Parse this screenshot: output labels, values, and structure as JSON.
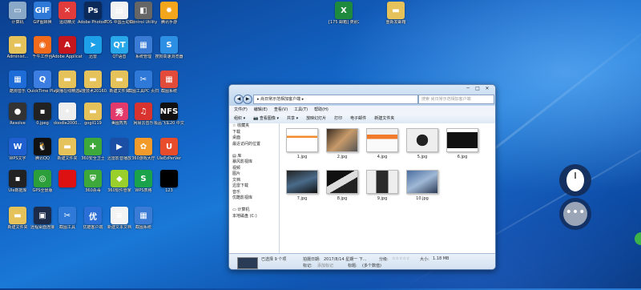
{
  "desktop_icons": [
    {
      "label": "计算机",
      "color": "#8aa9c8",
      "glyph": "▭"
    },
    {
      "label": "GIF图转换",
      "color": "#2f7ad8",
      "glyph": "GIF"
    },
    {
      "label": "运动精灵",
      "color": "#e23b3b",
      "glyph": "✕"
    },
    {
      "label": "Adobe Photosh...",
      "color": "#0b2a59",
      "glyph": "Ps"
    },
    {
      "label": "TDS 中国互动转化…",
      "color": "#f2f2f2",
      "glyph": "▤"
    },
    {
      "label": "Control Utility",
      "color": "#666",
      "glyph": "◧"
    },
    {
      "label": "腾讯手游",
      "color": "#f3a51b",
      "glyph": "✹"
    },
    {
      "label": "Administ...",
      "color": "#e6c25a",
      "glyph": "▬"
    },
    {
      "label": "千牛工作台",
      "color": "#f26a1b",
      "glyph": "◉"
    },
    {
      "label": "Adobe Applicati...",
      "color": "#c4161c",
      "glyph": "A"
    },
    {
      "label": "迅雷",
      "color": "#1ea0e8",
      "glyph": "➤"
    },
    {
      "label": "QT语音",
      "color": "#28a8ea",
      "glyph": "QT"
    },
    {
      "label": "系统管理",
      "color": "#3a7bd5",
      "glyph": "▦"
    },
    {
      "label": "搜狗高速浏览器",
      "color": "#2d8fe3",
      "glyph": "S"
    },
    {
      "label": "酷狗音乐",
      "color": "#1e6cd8",
      "glyph": "▦"
    },
    {
      "label": "QuickTime Player",
      "color": "#3b7de0",
      "glyph": "Q"
    },
    {
      "label": "快播在线精选",
      "color": "#e6c25a",
      "glyph": "▬"
    },
    {
      "label": "深度技术20160...",
      "color": "#e6c25a",
      "glyph": "▬"
    },
    {
      "label": "新建文件夹",
      "color": "#e6c25a",
      "glyph": "▬"
    },
    {
      "label": "截图工具PC 页扫描",
      "color": "#2f7ad8",
      "glyph": "✂"
    },
    {
      "label": "截图系统",
      "color": "#e24a3a",
      "glyph": "▦"
    },
    {
      "label": "Resolve",
      "color": "#333",
      "glyph": "●"
    },
    {
      "label": "0.jpeg",
      "color": "#222",
      "glyph": "▪"
    },
    {
      "label": "doodle2000...",
      "color": "#eee",
      "glyph": "✦"
    },
    {
      "label": "gogil119",
      "color": "#e6c25a",
      "glyph": "▬"
    },
    {
      "label": "美图秀秀",
      "color": "#e23b6b",
      "glyph": "秀"
    },
    {
      "label": "网易云音乐",
      "color": "#d9332f",
      "glyph": "♫"
    },
    {
      "label": "极品飞车20 中文版",
      "color": "#111",
      "glyph": "NFS"
    },
    {
      "label": "WPS文字",
      "color": "#1f5fcf",
      "glyph": "W"
    },
    {
      "label": "腾讯QQ",
      "color": "#111",
      "glyph": "🐧"
    },
    {
      "label": "新建文件夹",
      "color": "#e6c25a",
      "glyph": "▬"
    },
    {
      "label": "360安全卫士",
      "color": "#3ea83a",
      "glyph": "✚"
    },
    {
      "label": "迅雷影音播放",
      "color": "#1b4fa5",
      "glyph": "▶"
    },
    {
      "label": "360游戏大厅",
      "color": "#f29b2b",
      "glyph": "✿"
    },
    {
      "label": "UleEzPerVer",
      "color": "#e84c2b",
      "glyph": "U"
    },
    {
      "label": "Ule数据库",
      "color": "#222",
      "glyph": "▪"
    },
    {
      "label": "GPS全景版",
      "color": "#2c9e3a",
      "glyph": "◎"
    },
    {
      "label": "",
      "color": "#d11",
      "glyph": ""
    },
    {
      "label": "360杀毒",
      "color": "#3ea83a",
      "glyph": "⛨"
    },
    {
      "label": "360软件管家",
      "color": "#9ad02b",
      "glyph": "◆"
    },
    {
      "label": "WPS表格",
      "color": "#1aa34a",
      "glyph": "S"
    },
    {
      "label": "123",
      "color": "#000",
      "glyph": ""
    },
    {
      "label": "新建文件夹",
      "color": "#e6c25a",
      "glyph": "▬"
    },
    {
      "label": "远程桌面连接",
      "color": "#1c2b4a",
      "glyph": "▣"
    },
    {
      "label": "截图工具",
      "color": "#2f7ad8",
      "glyph": "✂"
    },
    {
      "label": "优酷客户端",
      "color": "#2b6fd6",
      "glyph": "优"
    },
    {
      "label": "新建文本文档",
      "color": "#f4f4f4",
      "glyph": "≡"
    },
    {
      "label": "截图系统",
      "color": "#3a7bd5",
      "glyph": "▦"
    }
  ],
  "top_files": [
    {
      "label": "[175 邮箱] 类别2表格",
      "color": "#1e8a3e",
      "glyph": "X"
    },
    {
      "label": "重新发邮箱",
      "color": "#e6c25a",
      "glyph": "▬"
    }
  ],
  "explorer": {
    "address": "▸ 尚日常示范相加客户端 ▸",
    "search_placeholder": "搜索 尚日常示范相加客户端",
    "menus": [
      "文件(F)",
      "编辑(E)",
      "查看(V)",
      "工具(T)",
      "帮助(H)"
    ],
    "toolbar": [
      "组织 ▾",
      "📷 查看图像 ▾",
      "共享 ▾",
      "放映幻灯片",
      "打印",
      "电子邮件",
      "新建文件夹"
    ],
    "nav": [
      "☆ 收藏夹",
      "  下载",
      "  桌面",
      "  最近访问的位置",
      "",
      "▤ 库",
      "  暴风影视库",
      "  视频",
      "  图片",
      "  文档",
      "  迅雷下载",
      "  音乐",
      "  优酷影视库",
      "",
      "▭ 计算机",
      "  本地磁盘 (C:)"
    ],
    "files": [
      {
        "name": "1.jpg",
        "kind": "web"
      },
      {
        "name": "2.jpg",
        "kind": "photo"
      },
      {
        "name": "4.jpg",
        "kind": "orange"
      },
      {
        "name": "5.jpg",
        "kind": "phone"
      },
      {
        "name": "6.jpg",
        "kind": "dark"
      },
      {
        "name": "7.jpg",
        "kind": "screen"
      },
      {
        "name": "8.jpg",
        "kind": "screen2"
      },
      {
        "name": "9.jpg",
        "kind": "phone2"
      },
      {
        "name": "10.jpg",
        "kind": "laptop"
      }
    ],
    "details": {
      "selected": "已选择 9 个项",
      "date_label": "拍摄日期:",
      "date_value": "2017/8/14 星期一 下...",
      "tags_label": "标记:",
      "tags_value": "添加标记",
      "rating_label": "分级:",
      "rating_value": "☆☆☆☆☆",
      "size_label": "大小:",
      "size_value": "1.18 MB",
      "title_label": "标题:",
      "title_value": "(多个数值)"
    }
  },
  "colors": {
    "accent": "#1a78d6"
  }
}
